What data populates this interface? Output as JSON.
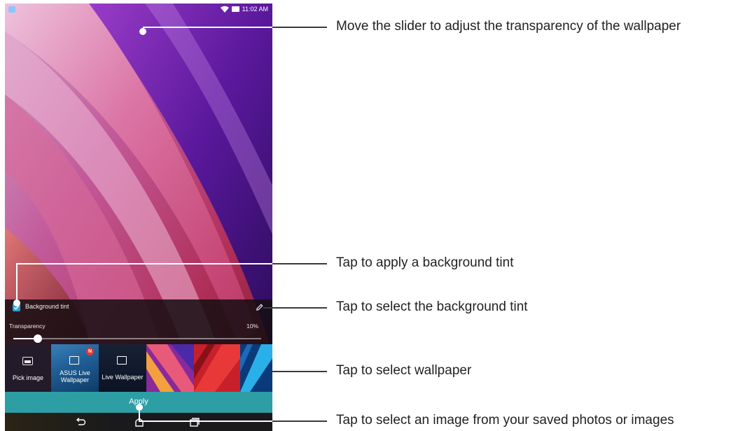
{
  "status_bar": {
    "time": "11:02 AM",
    "icons": [
      "notification-icon",
      "wifi-icon",
      "battery-icon"
    ]
  },
  "panel": {
    "background_tint_label": "Background tint",
    "background_tint_checked": true,
    "transparency_label": "Transparency",
    "transparency_value": "10%",
    "transparency_fraction": 0.1
  },
  "thumbnails": {
    "pick_image_label": "Pick image",
    "asus_live_label_line1": "ASUS Live",
    "asus_live_label_line2": "Wallpaper",
    "asus_badge": "N",
    "live_wallpaper_label": "Live Wallpaper"
  },
  "apply_label": "Apply",
  "nav_icons": [
    "back-icon",
    "home-icon",
    "recents-icon"
  ],
  "callouts": {
    "slider": "Move the slider to adjust the transparency of the wallpaper",
    "apply_tint": "Tap to apply a background tint",
    "select_tint": "Tap to select the background tint",
    "select_wallpaper": "Tap to select wallpaper",
    "select_image": "Tap to select an image from your saved photos or images"
  },
  "colors": {
    "accent": "#2e9ea5",
    "checkbox": "#2aa4d8",
    "badge": "#e53935",
    "callout_line": "#3a3a3a"
  }
}
